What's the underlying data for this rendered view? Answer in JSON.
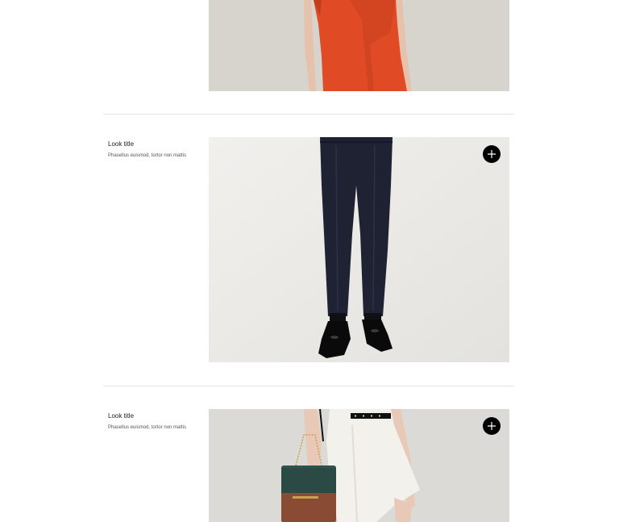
{
  "looks": [
    {
      "title": "",
      "subtitle": "",
      "image": "look-photo-red-dress",
      "background": "#d6d4cd",
      "accent": "#e04a25"
    },
    {
      "title": "Look title",
      "subtitle": "Phasellus euismod, tortor non mattis",
      "image": "look-photo-navy-trousers",
      "background": "#ecebe8",
      "accent": "#1f2233",
      "add_icon": "plus-icon"
    },
    {
      "title": "Look title",
      "subtitle": "Phasellus euismod, tortor non mattis",
      "image": "look-photo-white-skirt-bag",
      "background": "#dcdad6",
      "accent": "#2b4a45",
      "add_icon": "plus-icon"
    }
  ]
}
